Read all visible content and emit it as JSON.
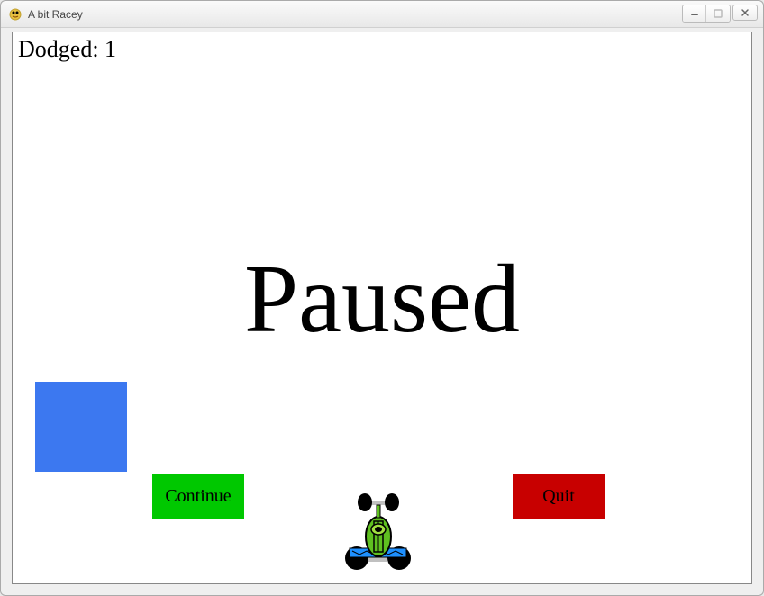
{
  "window": {
    "title": "A bit Racey"
  },
  "game": {
    "score_label": "Dodged:",
    "score_value": 1,
    "score_text": "Dodged: 1",
    "paused_text": "Paused"
  },
  "buttons": {
    "continue_label": "Continue",
    "quit_label": "Quit"
  },
  "colors": {
    "obstacle": "#3c78f0",
    "continue_button": "#00c800",
    "quit_button": "#c80000"
  }
}
